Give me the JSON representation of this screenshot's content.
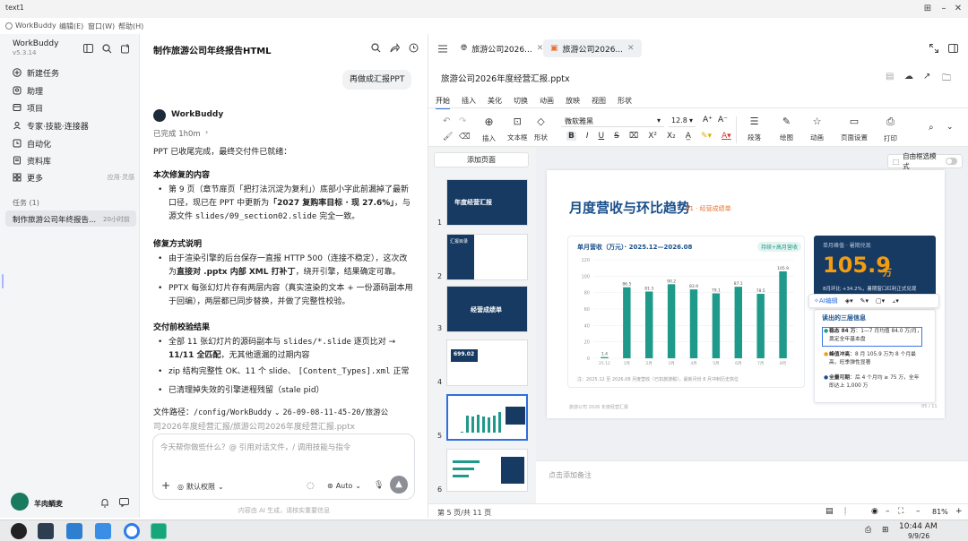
{
  "window": {
    "title": "text1"
  },
  "menubar": {
    "app": "WorkBuddy",
    "edit": "编辑(E)",
    "window": "窗口(W)",
    "help": "帮助(H)"
  },
  "sidebar": {
    "app_name": "WorkBuddy",
    "version": "v5.3.14",
    "items": [
      {
        "label": "新建任务",
        "icon": "plus-circle-icon"
      },
      {
        "label": "助理",
        "icon": "assistant-icon"
      },
      {
        "label": "项目",
        "icon": "folder-icon"
      },
      {
        "label": "专家·技能·连接器",
        "icon": "expert-icon"
      },
      {
        "label": "自动化",
        "icon": "clock-icon"
      },
      {
        "label": "资料库",
        "icon": "library-icon"
      },
      {
        "label": "更多",
        "icon": "grid-icon"
      }
    ],
    "more_hint": "应用·灵感",
    "tasks_header": "任务 (1)",
    "task_title": "制作旅游公司年终报告...",
    "task_time": "20小时前",
    "user_name": "羊肉鲷麦"
  },
  "chat": {
    "title": "制作旅游公司年终报告HTML",
    "user_msg": "再做成汇报PPT",
    "bot_name": "WorkBuddy",
    "status": "已完成 1h0m",
    "intro": "PPT 已收尾完成，最终交付件已就绪：",
    "sec1_title": "本次修复的内容",
    "sec1_b1_pre": "第 9 页（章节扉页「把打法沉淀为复利」）底部小字此前漏掉了最新口径，现已在 PPT 中更新为",
    "sec1_b1_bold": "「2027 复购率目标 · 现 27.6%」",
    "sec1_b1_mid": "，与源文件",
    "sec1_b1_code": "slides/09_section02.slide",
    "sec1_b1_post": "完全一致。",
    "sec2_title": "修复方式说明",
    "sec2_b1_pre": "由于渲染引擎的后台保存一直报 HTTP 500（连接不稳定），这次改为",
    "sec2_b1_bold": "直接对 .pptx 内部 XML 打补丁",
    "sec2_b1_post": "，绕开引擎，结果确定可靠。",
    "sec2_b2": "PPTX 每张幻灯片存有两层内容（真实渲染的文本 + 一份源码副本用于回编），两层都已同步替换，并做了完整性校验。",
    "sec3_title": "交付前校验结果",
    "sec3_b1_pre": "全部 11 张幻灯片的源码副本与",
    "sec3_b1_code": "slides/*.slide",
    "sec3_b1_mid": "逐页比对 →",
    "sec3_b1_bold": "11/11 全匹配",
    "sec3_b1_post": "，无其他遗漏的过期内容",
    "sec3_b2_pre": "zip 结构完整性 OK、11 个 slide、",
    "sec3_b2_code": "[Content_Types].xml",
    "sec3_b2_post": "正常",
    "sec3_b3": "已清理掉失效的引擎进程残留（stale pid）",
    "path_label": "文件路径：",
    "path_code": "/config/WorkBuddy",
    "path_rest": "26-09-08-11-45-20/旅游公",
    "path_line2": "司2026年度经营汇报/旅游公司2026年度经营汇报.pptx",
    "input_placeholder": "今天帮你做些什么？@ 引用对话文件，/ 调用技能与指令",
    "permission": "默认权限",
    "model": "Auto",
    "disclaimer": "内容由 AI 生成，请核实重要信息"
  },
  "right": {
    "tab1": "旅游公司2026...",
    "tab2": "旅游公司2026...",
    "file_name": "旅游公司2026年度经营汇报.pptx",
    "ribbon_tabs": [
      "开始",
      "插入",
      "美化",
      "切换",
      "动画",
      "放映",
      "视图",
      "形状"
    ],
    "tools": {
      "insert": "插入",
      "textbox": "文本框",
      "shape": "形状",
      "paragraph": "段落",
      "draw": "绘图",
      "animation": "动画",
      "page_setup": "页面设置",
      "print": "打印"
    },
    "font_name": "微软雅黑",
    "font_size": "12.8",
    "add_page": "添加页面",
    "free_select": "自由框选模式",
    "notes_placeholder": "点击添加备注",
    "page_info": "第 5 页/共 11 页",
    "zoom": "81%",
    "thumb_labels": {
      "t1": "年度经营汇报",
      "t2": "汇报目录",
      "t3": "经营成绩单",
      "t4": "699.02"
    },
    "slide_numbers": [
      "1",
      "2",
      "3",
      "4",
      "5",
      "6"
    ]
  },
  "slide": {
    "title": "月度营收与环比趋势",
    "subtitle": "01 · 经营成绩单",
    "chart_title": "单月营收（万元）· 2025.12—2026.08",
    "chart_tag": "持续+高月营收",
    "footnote": "注：2025.12 至 2026.08 月度营收（已扣旅游税），最新月份 8 月冲刺历史高位",
    "footer_left": "旅游公司 2026 年度经营汇报",
    "footer_right": "05 / 11",
    "kpi_label": "单月峰值 · 暑期兑现",
    "kpi_value": "105.9",
    "kpi_unit": "万",
    "kpi_desc": "8月环比 +34.2%，暑期窗口红利正式兑现",
    "ai_edit": "AI编辑",
    "insights_title": "读出的三层信息",
    "insights": [
      {
        "bold": "稳态 84 万",
        "rest": "：1—7 月均值 84.0 万/月，奠定全年基本盘"
      },
      {
        "bold": "峰值冲高",
        "rest": "：8 月 105.9 万为 8 个月最高，旺季弹性显著"
      },
      {
        "bold": "全量可期",
        "rest": "：后 4 个月均 ≥ 75 万，全年即达上 1,000 万"
      }
    ]
  },
  "chart_data": {
    "type": "bar",
    "title": "单月营收（万元）· 2025.12—2026.08",
    "categories": [
      "25.12",
      "1月",
      "2月",
      "3月",
      "4月",
      "5月",
      "6月",
      "7月",
      "8月"
    ],
    "values": [
      1.4,
      86.5,
      81.3,
      90.2,
      83.9,
      79.1,
      87.1,
      78.5,
      105.9
    ],
    "yticks": [
      "0",
      "20",
      "40",
      "60",
      "80",
      "100",
      "120"
    ],
    "ylim": [
      0,
      120
    ],
    "color": "#1f9a8a",
    "grid": true
  },
  "taskbar": {
    "time": "10:44 AM",
    "date": "9/9/26"
  },
  "colors": {
    "accent": "#1a4f8c",
    "teal": "#1f9a8a",
    "kpi_bg": "#173a63",
    "kpi_orange": "#f39c12"
  }
}
